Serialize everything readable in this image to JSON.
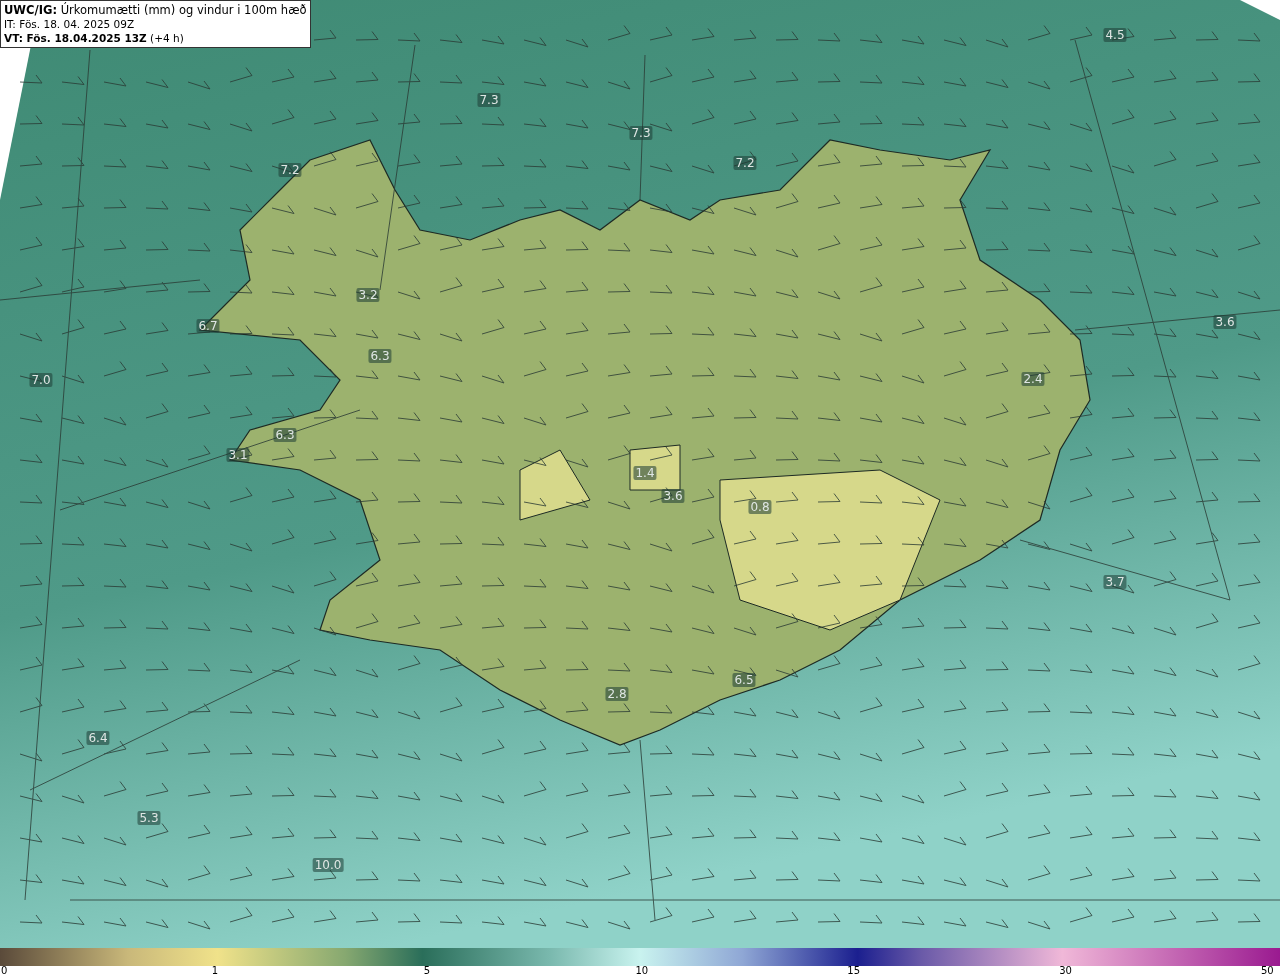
{
  "title_box": {
    "lines": [
      "**UWC/IG:** Úrkomumætti (mm) og vindur i 100m hæð",
      "IT: Fös. 18. 04. 2025 09Z",
      "**VT: Fös. 18.04.2025 13Z** (+4 h)"
    ]
  },
  "map": {
    "value_labels": [
      "4.5",
      "7.3",
      "7.3",
      "7.2",
      "7.2",
      "3.2",
      "6.7",
      "6.3",
      "7.0",
      "3.6",
      "2.4",
      "6.3",
      "3.1",
      "1.4",
      "3.6",
      "0.8",
      "3.7",
      "6.5",
      "2.8",
      "6.4",
      "5.3",
      "10.0"
    ]
  },
  "color_scale": {
    "ticks": [
      "0",
      "1",
      "5",
      "10",
      "15",
      "30",
      "50"
    ]
  }
}
